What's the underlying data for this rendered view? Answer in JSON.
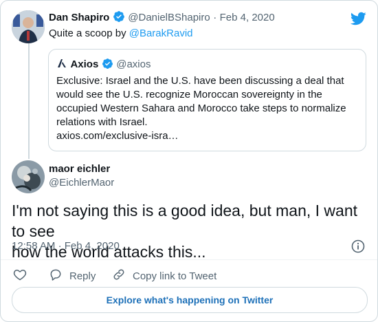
{
  "header": {
    "brand_icon": "twitter-bird-icon",
    "brand_color": "#1d9bf0"
  },
  "parent_tweet": {
    "display_name": "Dan Shapiro",
    "handle": "@DanielBShapiro",
    "separator": "·",
    "date": "Feb 4, 2020",
    "text_prefix": "Quite a scoop by ",
    "mention": "@BarakRavid"
  },
  "quoted_tweet": {
    "display_name": "Axios",
    "handle": "@axios",
    "text_lines": [
      "Exclusive: Israel and the U.S. have been discussing a deal that",
      "would see the U.S. recognize Moroccan sovereignty in the",
      "occupied Western Sahara and Morocco take steps to normalize",
      "relations with Israel."
    ],
    "link": "axios.com/exclusive-isra…"
  },
  "main_tweet": {
    "display_name": "maor eichler",
    "handle": "@EichlerMaor",
    "text_lines": [
      "I'm not saying this is a good idea, but man, I want to see",
      "how the world attacks this..."
    ],
    "time": "12:58 AM",
    "separator": "·",
    "date": "Feb 4, 2020"
  },
  "actions": {
    "reply_label": "Reply",
    "copy_link_label": "Copy link to Tweet"
  },
  "footer": {
    "explore_label": "Explore what's happening on Twitter"
  },
  "colors": {
    "accent": "#1d9bf0",
    "text": "#0f1419",
    "muted": "#536471",
    "border": "#cfd9de"
  }
}
